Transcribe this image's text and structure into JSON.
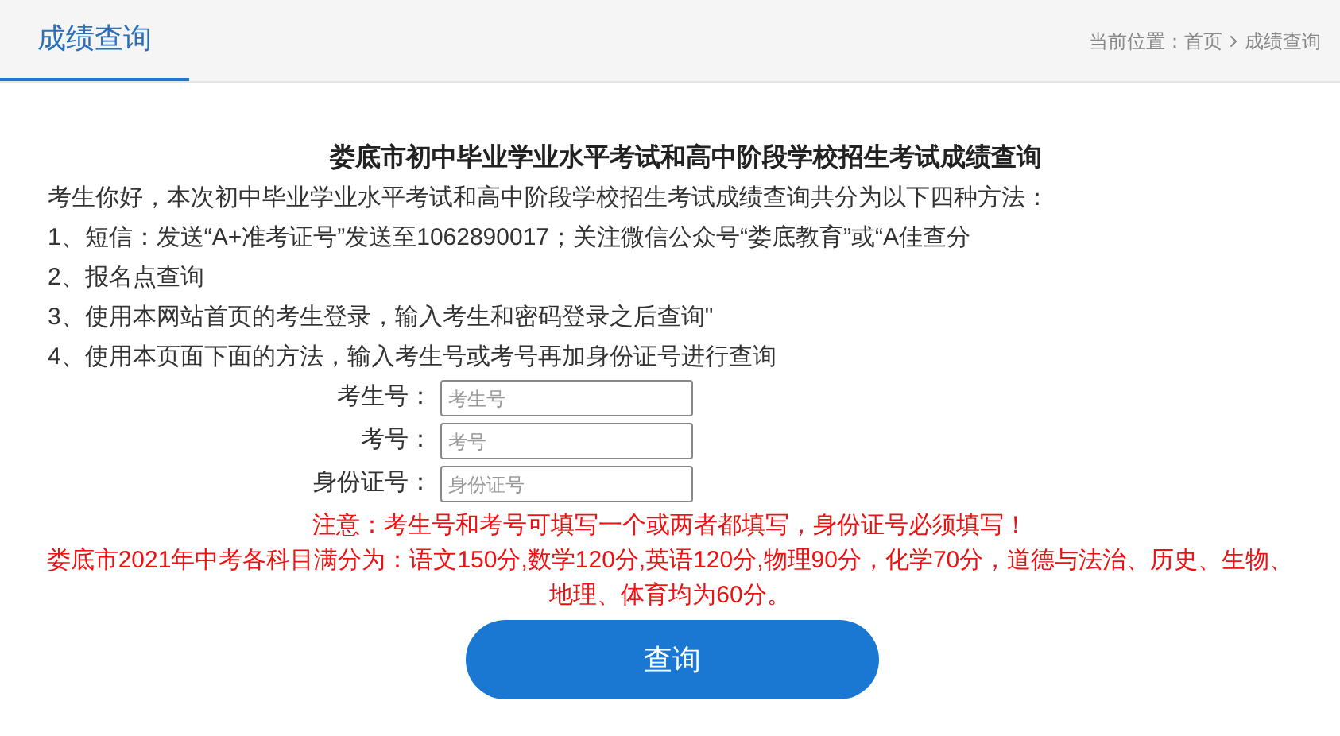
{
  "header": {
    "tab": {
      "label": "成绩查询",
      "selected": true
    },
    "breadcrumb": {
      "prefix": "当前位置：",
      "items": [
        "首页",
        "成绩查询"
      ]
    }
  },
  "title": "娄底市初中毕业学业水平考试和高中阶段学校招生考试成绩查询",
  "intro": "考生你好，本次初中毕业学业水平考试和高中阶段学校招生考试成绩查询共分为以下四种方法：",
  "methods": [
    "1、短信：发送“A+准考证号”发送至1062890017；关注微信公众号“娄底教育”或“A佳查分",
    "2、报名点查询",
    "3、使用本网站首页的考生登录，输入考生和密码登录之后查询\"",
    "4、使用本页面下面的方法，输入考生号或考号再加身份证号进行查询"
  ],
  "form": {
    "fields": [
      {
        "label": "考生号：",
        "placeholder": "考生号"
      },
      {
        "label": "考号：",
        "placeholder": "考号"
      },
      {
        "label": "身份证号：",
        "placeholder": "身份证号"
      }
    ]
  },
  "notices": [
    "注意：考生号和考号可填写一个或两者都填写，身份证号必须填写！",
    "娄底市2021年中考各科目满分为：语文150分,数学120分,英语120分,物理90分，化学70分，道德与法治、历史、生物、地理、体育均为60分。"
  ],
  "submit_button": "查询"
}
